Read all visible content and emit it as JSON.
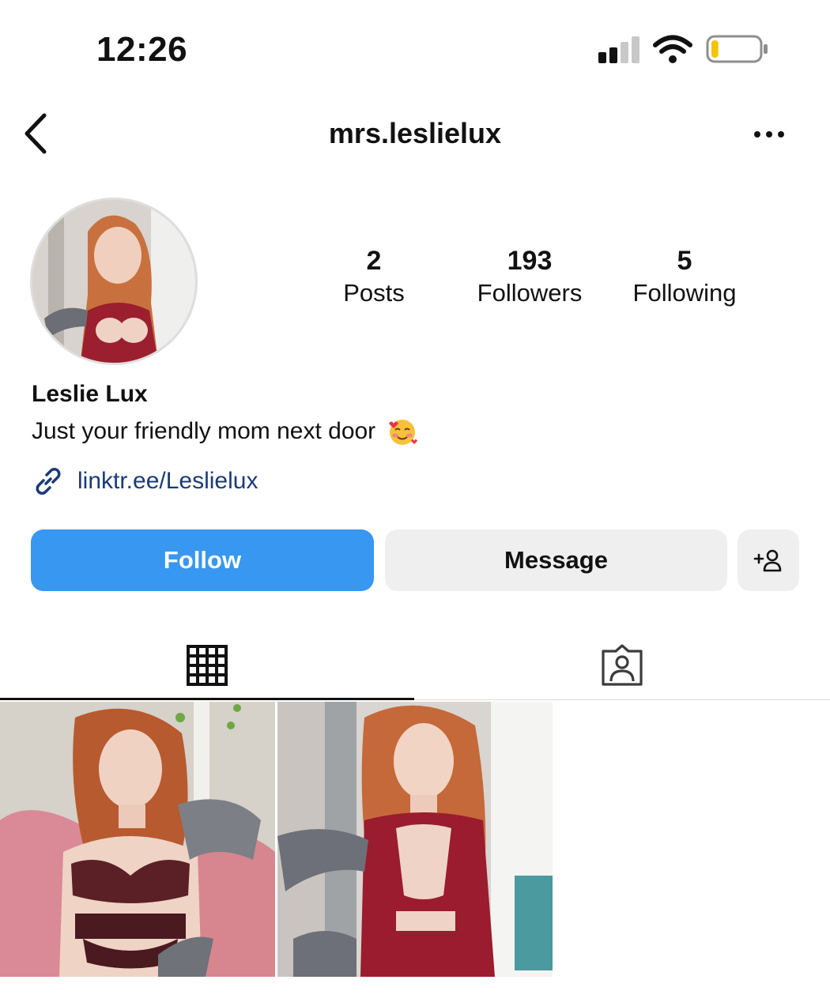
{
  "status_bar": {
    "time": "12:26",
    "signal_icon": "cellular-signal-icon",
    "wifi_icon": "wifi-icon",
    "battery_icon": "battery-low-icon",
    "battery_level": 0.15,
    "battery_color": "#f5c400"
  },
  "header": {
    "username": "mrs.leslielux",
    "back_icon": "chevron-left-icon",
    "more_icon": "more-horizontal-icon"
  },
  "profile": {
    "avatar_icon": "profile-photo",
    "stats": {
      "posts_count": "2",
      "posts_label": "Posts",
      "followers_count": "193",
      "followers_label": "Followers",
      "following_count": "5",
      "following_label": "Following"
    },
    "display_name": "Leslie Lux",
    "bio": "Just your friendly mom next door",
    "bio_emoji_icon": "smiling-face-with-hearts-emoji",
    "link": "linktr.ee/Leslielux",
    "link_icon": "link-icon",
    "link_color": "#1b3a78"
  },
  "actions": {
    "follow_label": "Follow",
    "message_label": "Message",
    "suggest_icon": "add-person-icon",
    "follow_color": "#3897f0"
  },
  "tabs": [
    {
      "name": "posts-grid",
      "icon": "grid-icon",
      "active": true
    },
    {
      "name": "tagged",
      "icon": "tagged-person-icon",
      "active": false
    }
  ],
  "posts": [
    {
      "thumbnail": "photo-1"
    },
    {
      "thumbnail": "photo-2"
    }
  ]
}
